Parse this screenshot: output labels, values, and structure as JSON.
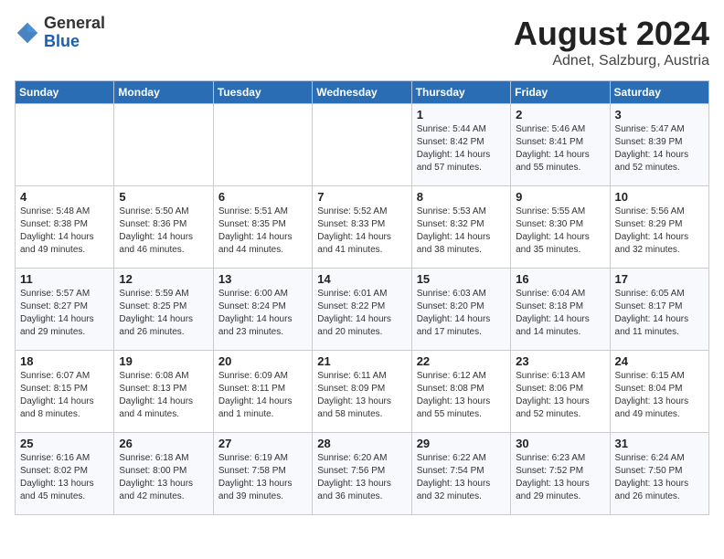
{
  "header": {
    "logo_general": "General",
    "logo_blue": "Blue",
    "title": "August 2024",
    "subtitle": "Adnet, Salzburg, Austria"
  },
  "weekdays": [
    "Sunday",
    "Monday",
    "Tuesday",
    "Wednesday",
    "Thursday",
    "Friday",
    "Saturday"
  ],
  "weeks": [
    [
      {
        "day": "",
        "info": ""
      },
      {
        "day": "",
        "info": ""
      },
      {
        "day": "",
        "info": ""
      },
      {
        "day": "",
        "info": ""
      },
      {
        "day": "1",
        "info": "Sunrise: 5:44 AM\nSunset: 8:42 PM\nDaylight: 14 hours\nand 57 minutes."
      },
      {
        "day": "2",
        "info": "Sunrise: 5:46 AM\nSunset: 8:41 PM\nDaylight: 14 hours\nand 55 minutes."
      },
      {
        "day": "3",
        "info": "Sunrise: 5:47 AM\nSunset: 8:39 PM\nDaylight: 14 hours\nand 52 minutes."
      }
    ],
    [
      {
        "day": "4",
        "info": "Sunrise: 5:48 AM\nSunset: 8:38 PM\nDaylight: 14 hours\nand 49 minutes."
      },
      {
        "day": "5",
        "info": "Sunrise: 5:50 AM\nSunset: 8:36 PM\nDaylight: 14 hours\nand 46 minutes."
      },
      {
        "day": "6",
        "info": "Sunrise: 5:51 AM\nSunset: 8:35 PM\nDaylight: 14 hours\nand 44 minutes."
      },
      {
        "day": "7",
        "info": "Sunrise: 5:52 AM\nSunset: 8:33 PM\nDaylight: 14 hours\nand 41 minutes."
      },
      {
        "day": "8",
        "info": "Sunrise: 5:53 AM\nSunset: 8:32 PM\nDaylight: 14 hours\nand 38 minutes."
      },
      {
        "day": "9",
        "info": "Sunrise: 5:55 AM\nSunset: 8:30 PM\nDaylight: 14 hours\nand 35 minutes."
      },
      {
        "day": "10",
        "info": "Sunrise: 5:56 AM\nSunset: 8:29 PM\nDaylight: 14 hours\nand 32 minutes."
      }
    ],
    [
      {
        "day": "11",
        "info": "Sunrise: 5:57 AM\nSunset: 8:27 PM\nDaylight: 14 hours\nand 29 minutes."
      },
      {
        "day": "12",
        "info": "Sunrise: 5:59 AM\nSunset: 8:25 PM\nDaylight: 14 hours\nand 26 minutes."
      },
      {
        "day": "13",
        "info": "Sunrise: 6:00 AM\nSunset: 8:24 PM\nDaylight: 14 hours\nand 23 minutes."
      },
      {
        "day": "14",
        "info": "Sunrise: 6:01 AM\nSunset: 8:22 PM\nDaylight: 14 hours\nand 20 minutes."
      },
      {
        "day": "15",
        "info": "Sunrise: 6:03 AM\nSunset: 8:20 PM\nDaylight: 14 hours\nand 17 minutes."
      },
      {
        "day": "16",
        "info": "Sunrise: 6:04 AM\nSunset: 8:18 PM\nDaylight: 14 hours\nand 14 minutes."
      },
      {
        "day": "17",
        "info": "Sunrise: 6:05 AM\nSunset: 8:17 PM\nDaylight: 14 hours\nand 11 minutes."
      }
    ],
    [
      {
        "day": "18",
        "info": "Sunrise: 6:07 AM\nSunset: 8:15 PM\nDaylight: 14 hours\nand 8 minutes."
      },
      {
        "day": "19",
        "info": "Sunrise: 6:08 AM\nSunset: 8:13 PM\nDaylight: 14 hours\nand 4 minutes."
      },
      {
        "day": "20",
        "info": "Sunrise: 6:09 AM\nSunset: 8:11 PM\nDaylight: 14 hours\nand 1 minute."
      },
      {
        "day": "21",
        "info": "Sunrise: 6:11 AM\nSunset: 8:09 PM\nDaylight: 13 hours\nand 58 minutes."
      },
      {
        "day": "22",
        "info": "Sunrise: 6:12 AM\nSunset: 8:08 PM\nDaylight: 13 hours\nand 55 minutes."
      },
      {
        "day": "23",
        "info": "Sunrise: 6:13 AM\nSunset: 8:06 PM\nDaylight: 13 hours\nand 52 minutes."
      },
      {
        "day": "24",
        "info": "Sunrise: 6:15 AM\nSunset: 8:04 PM\nDaylight: 13 hours\nand 49 minutes."
      }
    ],
    [
      {
        "day": "25",
        "info": "Sunrise: 6:16 AM\nSunset: 8:02 PM\nDaylight: 13 hours\nand 45 minutes."
      },
      {
        "day": "26",
        "info": "Sunrise: 6:18 AM\nSunset: 8:00 PM\nDaylight: 13 hours\nand 42 minutes."
      },
      {
        "day": "27",
        "info": "Sunrise: 6:19 AM\nSunset: 7:58 PM\nDaylight: 13 hours\nand 39 minutes."
      },
      {
        "day": "28",
        "info": "Sunrise: 6:20 AM\nSunset: 7:56 PM\nDaylight: 13 hours\nand 36 minutes."
      },
      {
        "day": "29",
        "info": "Sunrise: 6:22 AM\nSunset: 7:54 PM\nDaylight: 13 hours\nand 32 minutes."
      },
      {
        "day": "30",
        "info": "Sunrise: 6:23 AM\nSunset: 7:52 PM\nDaylight: 13 hours\nand 29 minutes."
      },
      {
        "day": "31",
        "info": "Sunrise: 6:24 AM\nSunset: 7:50 PM\nDaylight: 13 hours\nand 26 minutes."
      }
    ]
  ]
}
